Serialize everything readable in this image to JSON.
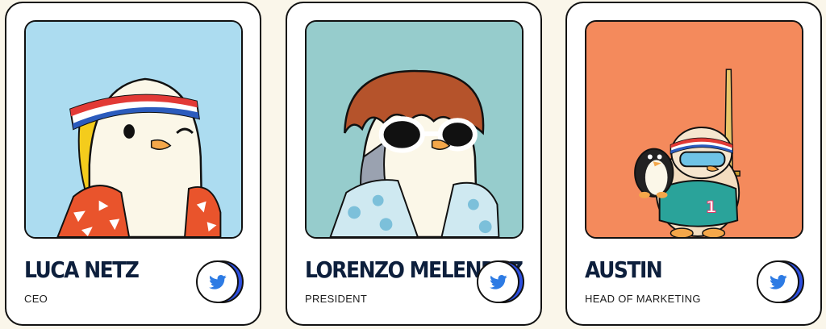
{
  "team": [
    {
      "name": "LUCA NETZ",
      "role": "CEO",
      "bg": "#acdcf0",
      "icon": "twitter-icon"
    },
    {
      "name": "LORENZO MELENDEZ",
      "role": "PRESIDENT",
      "bg": "#96cccc",
      "icon": "twitter-icon"
    },
    {
      "name": "AUSTIN",
      "role": "HEAD OF MARKETING",
      "bg": "#f48a5c",
      "icon": "twitter-icon"
    }
  ],
  "colors": {
    "page_bg": "#faf6ea",
    "twitter_blue": "#2d4fe0",
    "name_color": "#0d1f3c"
  }
}
